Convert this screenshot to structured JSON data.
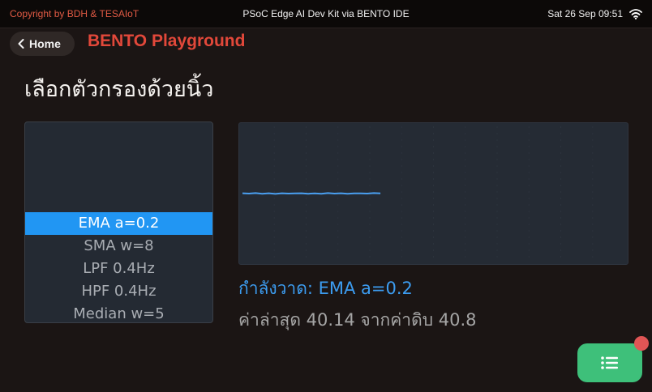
{
  "status_bar": {
    "copyright": "Copyright by BDH & TESAIoT",
    "device": "PSoC Edge AI Dev Kit via BENTO IDE",
    "datetime": "Sat 26 Sep 09:51",
    "wifi_icon": "wifi-icon"
  },
  "header": {
    "home_label": "Home",
    "app_title": "BENTO Playground"
  },
  "page": {
    "title": "เลือกตัวกรองด้วยนิ้ว"
  },
  "filters": {
    "selected_index": 0,
    "items": [
      "EMA a=0.2",
      "SMA w=8",
      "LPF 0.4Hz",
      "HPF 0.4Hz",
      "Median w=5"
    ]
  },
  "chart_data": {
    "type": "line",
    "series": [
      {
        "color": "#4a9ff0",
        "values": [
          40.2,
          40.0,
          40.3,
          39.9,
          40.2,
          39.8,
          40.2,
          40.0,
          40.1,
          40.2,
          39.9,
          40.1,
          39.9,
          40.3,
          40.0,
          40.2,
          39.9,
          40.1,
          40.1,
          40.0,
          40.3,
          40.1
        ]
      }
    ],
    "ylim": [
      0,
      80
    ]
  },
  "readout": {
    "current_filter": "กำลังวาด: EMA a=0.2",
    "latest": "ค่าล่าสุด 40.14 จากค่าดิบ 40.8"
  },
  "fab": {
    "icon": "list-icon"
  },
  "colors": {
    "accent": "#2196f3",
    "brand": "#e2483a",
    "fab": "#3ec07a",
    "badge": "#e05555"
  }
}
